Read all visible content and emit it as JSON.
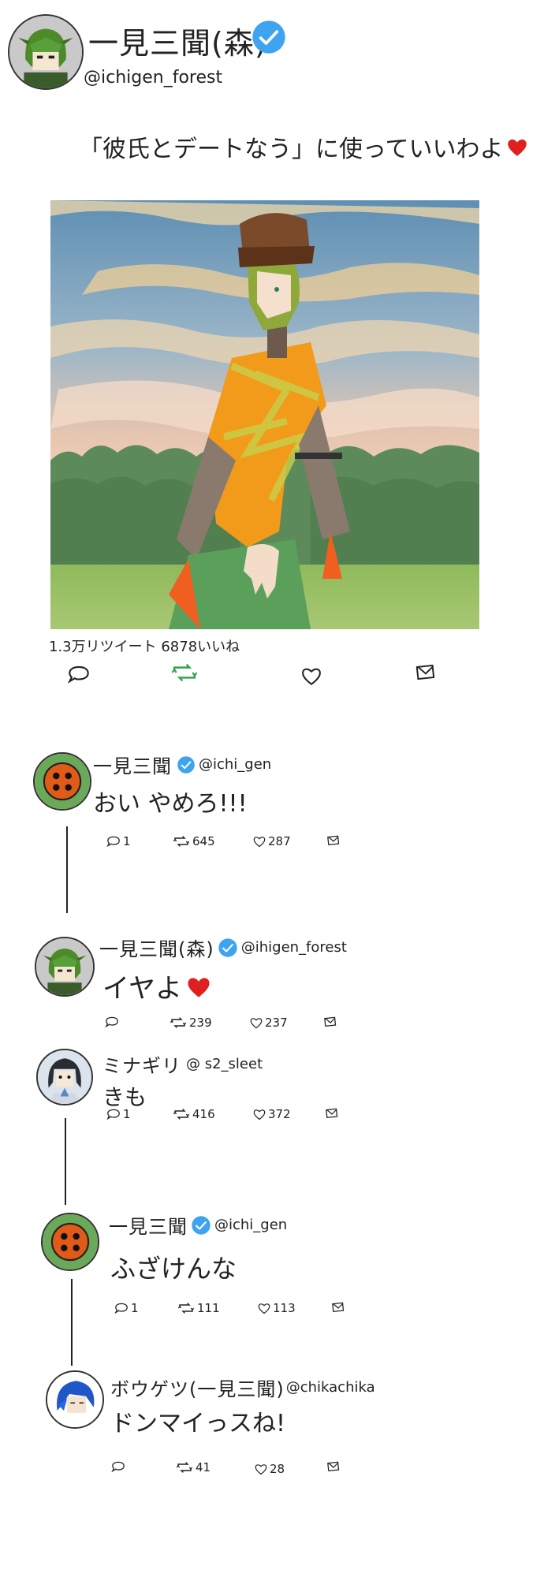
{
  "main": {
    "author_name": "一見三聞(森)",
    "handle": "@ichigen_forest",
    "text": "「彼氏とデートなう」に使っていいわよ",
    "stats_text": "1.3万リツイート 6878いいね"
  },
  "replies": [
    {
      "name": "一見三聞",
      "handle": "@ichi_gen",
      "text": "おい やめろ!!!",
      "reply": "1",
      "retweet": "645",
      "like": "287"
    },
    {
      "name": "一見三聞(森)",
      "handle": "@ihigen_forest",
      "text": "イヤよ",
      "reply": "",
      "retweet": "239",
      "like": "237"
    },
    {
      "name": "ミナギリ",
      "handle": "@ s2_sleet",
      "text": "きも",
      "reply": "1",
      "retweet": "416",
      "like": "372"
    },
    {
      "name": "一見三聞",
      "handle": "@ichi_gen",
      "text": "ふざけんな",
      "reply": "1",
      "retweet": "111",
      "like": "113"
    },
    {
      "name": "ボウゲツ(一見三聞)",
      "handle": "@chikachika",
      "text": "ドンマイっスね!",
      "reply": "",
      "retweet": "41",
      "like": "28"
    }
  ],
  "colors": {
    "verified": "#3fa4f0",
    "retweet_green": "#2aa14a",
    "heart_red": "#e02020"
  },
  "icons": [
    "reply-icon",
    "retweet-icon",
    "like-icon",
    "share-icon",
    "verified-icon",
    "heart-icon"
  ]
}
